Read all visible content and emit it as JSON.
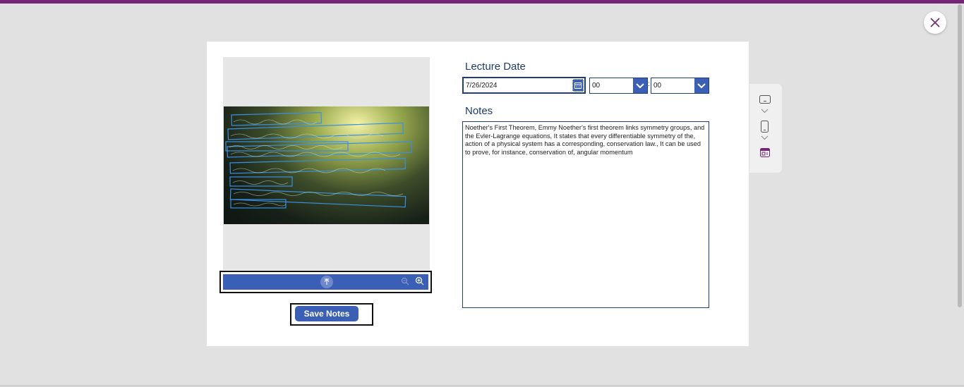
{
  "colors": {
    "top_bar": "#742774",
    "primary_button": "#3a5fb5",
    "label_text": "#1e3a70",
    "page_bg": "#e1e1e1",
    "modal_bg": "#ffffff"
  },
  "window": {
    "close_icon": "close-icon"
  },
  "image_preview": {
    "description_icon": "whiteboard-photo",
    "toolbar": {
      "upload_icon": "arrow-up-icon",
      "zoom_out_icon": "zoom-out-icon",
      "zoom_in_icon": "zoom-in-icon"
    }
  },
  "actions": {
    "save_label": "Save Notes"
  },
  "lecture_date": {
    "label": "Lecture Date",
    "date_value": "7/26/2024",
    "hour_value": "00",
    "minute_value": "00",
    "separator": ":"
  },
  "notes": {
    "label": "Notes",
    "value": "Noether's First Theorem, Emmy Noether's first theorem links symmetry groups, and the Evler-Lagrange equations, It states that every differentiable symmetry of the, action of a physical system has a corresponding, conservation law., It can be used to prove, for instance, conservation of, angular momentum"
  },
  "side_panel": {
    "icons": [
      "tablet-landscape-icon",
      "chevron-down-icon",
      "phone-icon",
      "chevron-down-icon",
      "browser-app-icon"
    ]
  }
}
